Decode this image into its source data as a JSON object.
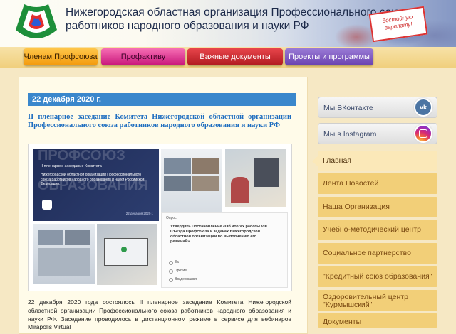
{
  "header": {
    "title_line1": "Нижегородская областная организация Профессионального союза",
    "title_line2": "работников народного образования и науки РФ",
    "poster_text": "достойную зарплату!"
  },
  "nav": {
    "items": [
      {
        "label": "Членам Профсоюза"
      },
      {
        "label": "Профактиву"
      },
      {
        "label": "Важные документы"
      },
      {
        "label": "Проекты и программы"
      }
    ]
  },
  "article": {
    "date": "22 декабря 2020 г.",
    "headline": "II пленарное заседание Комитета Нижегородской областной организации Профессионального союза работников народного образования и науки РФ",
    "slide": {
      "watermark1": "ПРОФСОЮЗ",
      "watermark2": "ОБРАЗОВАНИЯ",
      "title": "II пленарное заседание Комитета",
      "text": "Нижегородской областной организации Профессионального союза работников народного образования и науки Российской Федерации.",
      "date": "22 декабря 2020 г."
    },
    "poll": {
      "label": "Опрос",
      "question": "Утвердить Постановление «Об итогах работы VIII Съезда Профсоюза и задачах Нижегородской областной организации по выполнению его решений».",
      "options": [
        "За",
        "Против",
        "Воздержался"
      ]
    },
    "body": "22 декабря 2020 года состоялось II пленарное заседание Комитета Нижегородской областной организации Профессионального союза работников народного образования и науки РФ. Заседание проводилось в дистанционном режиме в сервисе для вебинаров Mirapolis Virtual"
  },
  "sidebar": {
    "social": [
      {
        "label": "Мы ВКонтакте",
        "icon": "vk-icon"
      },
      {
        "label": "Мы в Instagram",
        "icon": "instagram-icon"
      }
    ],
    "menu": [
      {
        "label": "Главная"
      },
      {
        "label": "Лента Новостей"
      },
      {
        "label": "Наша Организация"
      },
      {
        "label": "Учебно-методический центр"
      },
      {
        "label": "Социальное партнерство"
      },
      {
        "label": "\"Кредитный союз образования\""
      },
      {
        "label": "Оздоровительный центр \"Курмышский\""
      },
      {
        "label": "Документы"
      }
    ]
  },
  "colors": {
    "accent_blue": "#3a87cc",
    "headline_blue": "#1f6ec0",
    "menu_bg": "#f2cf78",
    "menu_text": "#7a4a12"
  }
}
